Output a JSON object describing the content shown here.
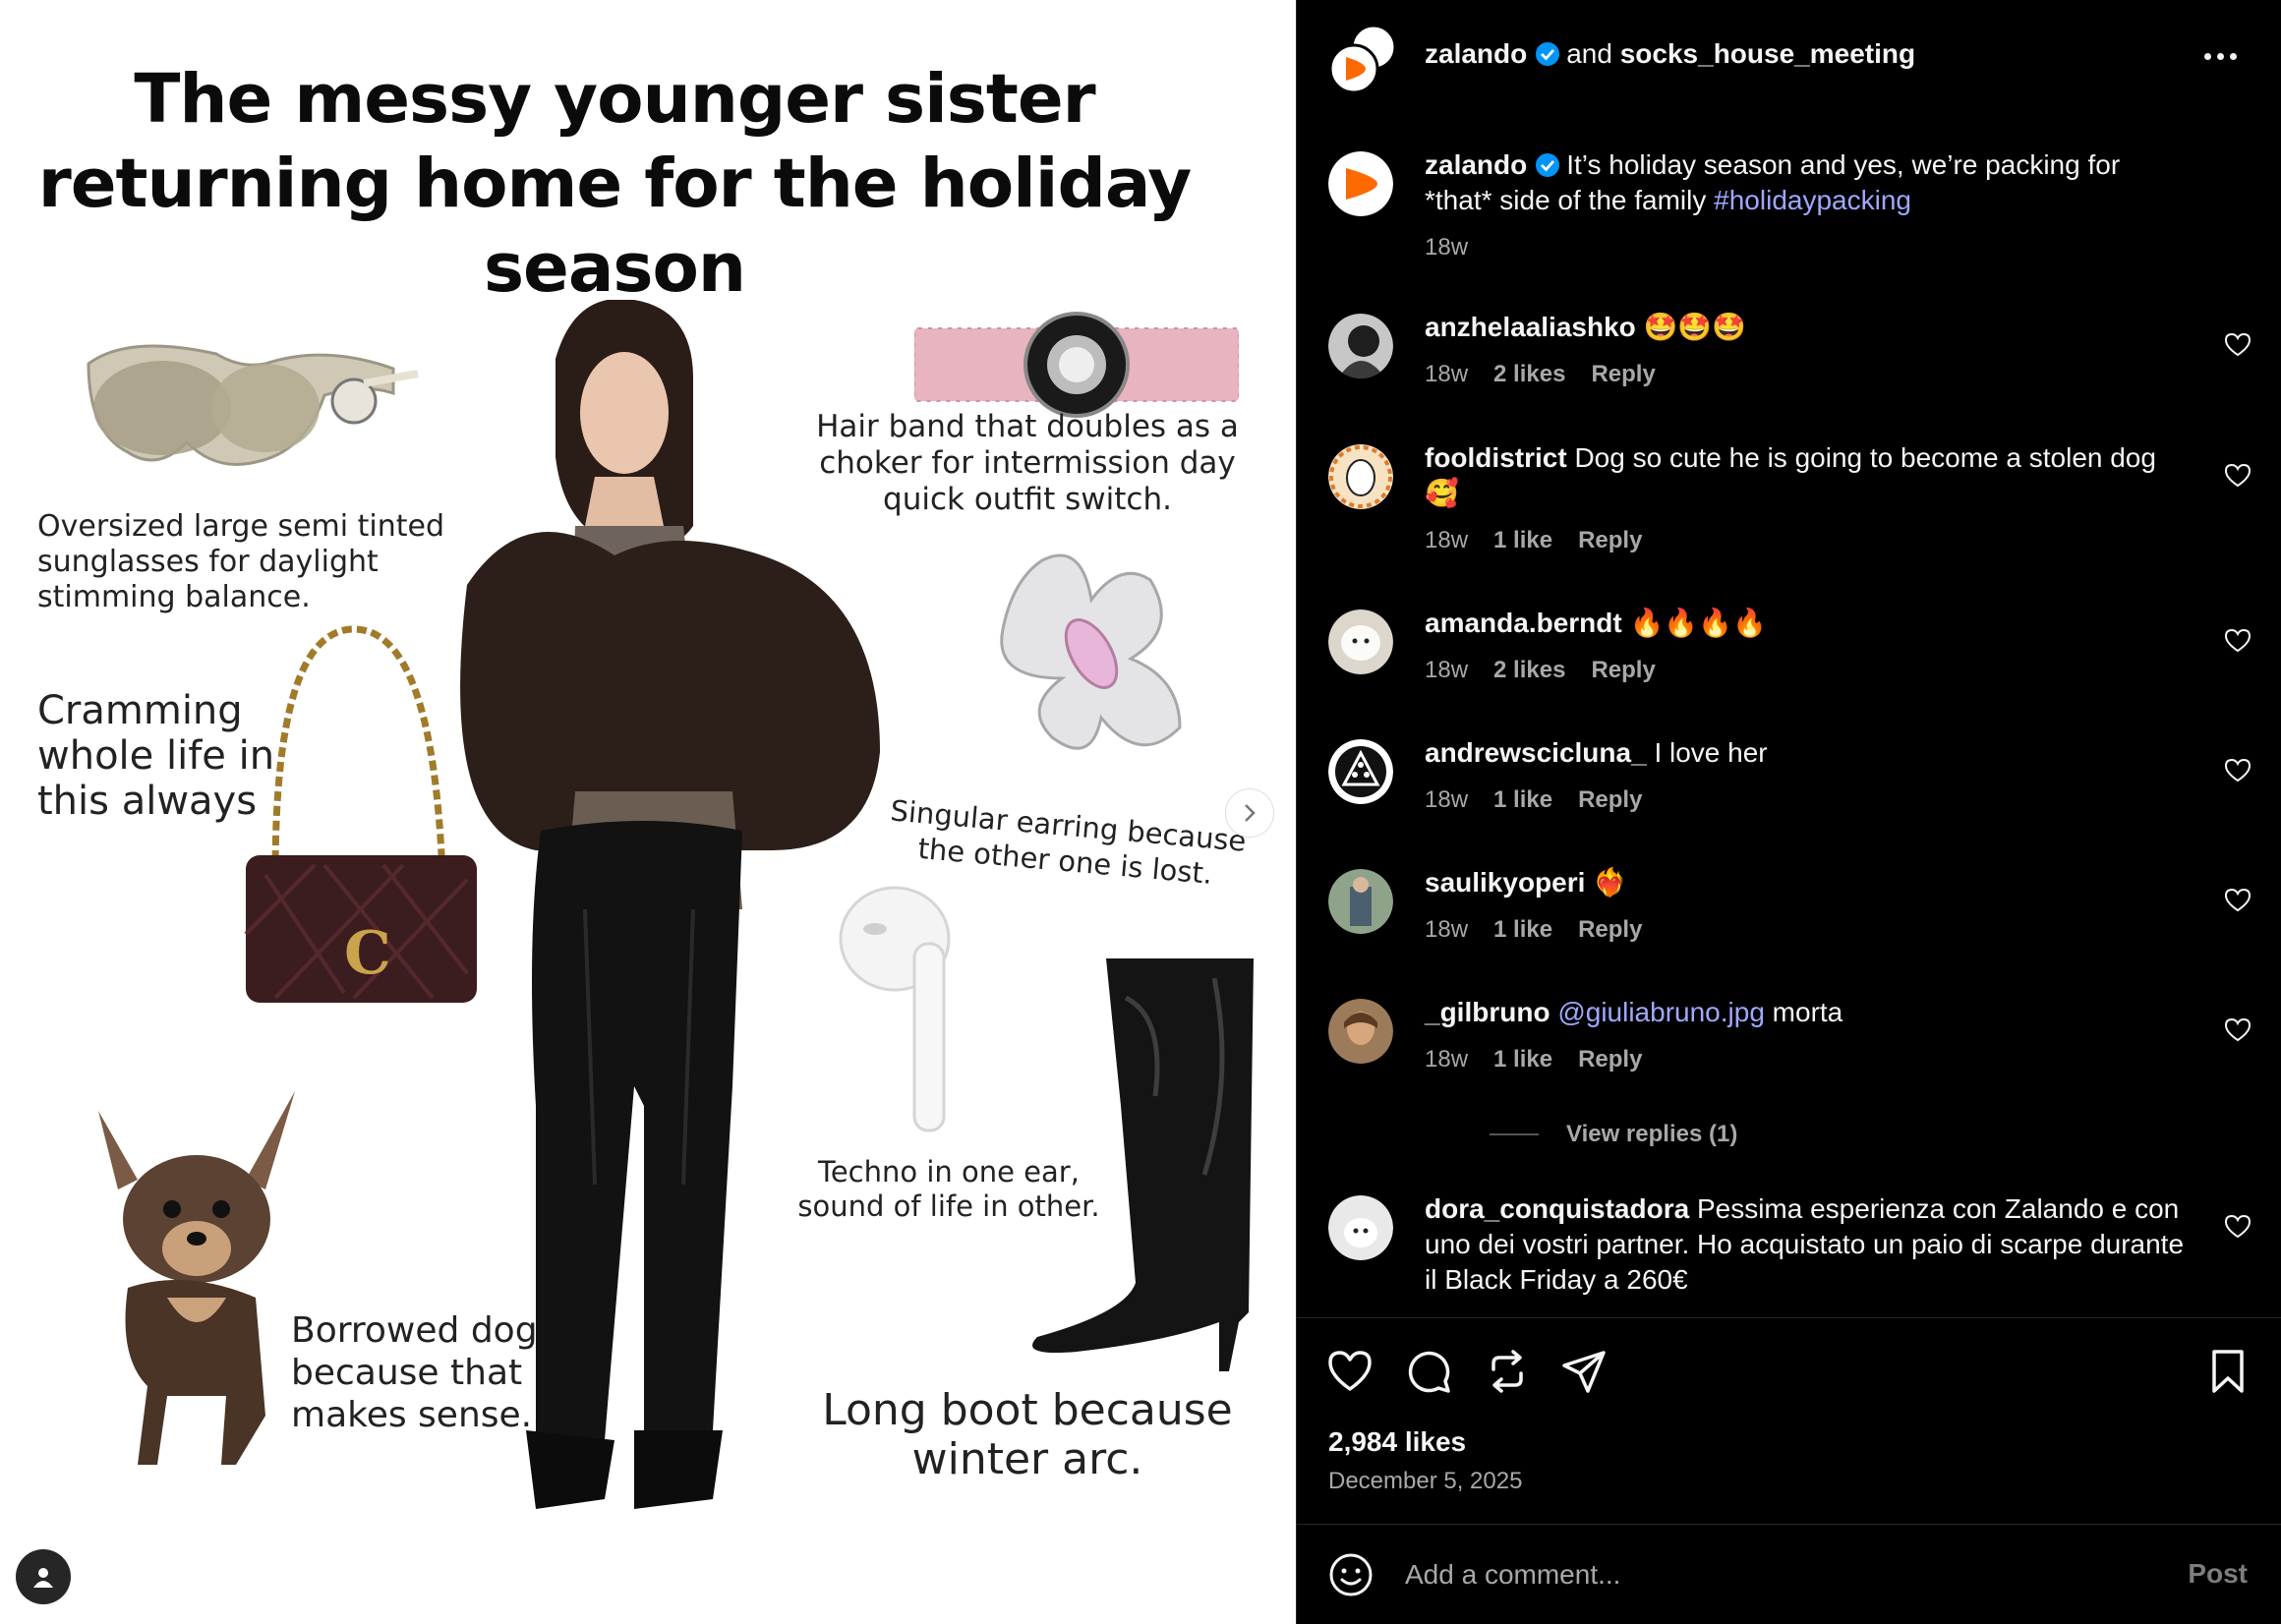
{
  "post_image": {
    "title": "The messy younger sister returning home for the holiday season",
    "captions": {
      "sunglasses": "Oversized large semi tinted sunglasses for daylight stimming balance.",
      "bag": "Cramming whole life in this always",
      "dog": "Borrowed dog because that makes sense.",
      "hairband": "Hair band that doubles as a choker for intermission day quick outfit switch.",
      "earring": "Singular earring because the other one is lost.",
      "earbud": "Techno in one ear, sound of life in other.",
      "boot": "Long boot because winter arc."
    },
    "icons": {
      "next": "chevron-right-icon",
      "user_tag": "person-icon"
    }
  },
  "header": {
    "author": "zalando",
    "joiner": "and",
    "collaborator": "socks_house_meeting"
  },
  "caption": {
    "author": "zalando",
    "text": "It’s holiday season and yes, we’re packing for *that* side of the family ",
    "hashtag": "#holidaypacking",
    "time": "18w"
  },
  "comments": [
    {
      "user": "anzhelaaliashko",
      "text": "🤩🤩🤩",
      "time": "18w",
      "likes": "2 likes",
      "reply": "Reply"
    },
    {
      "user": "fooldistrict",
      "text": "Dog so cute he is going to become a stolen dog 🥰",
      "time": "18w",
      "likes": "1 like",
      "reply": "Reply"
    },
    {
      "user": "amanda.berndt",
      "text": "🔥🔥🔥🔥",
      "time": "18w",
      "likes": "2 likes",
      "reply": "Reply"
    },
    {
      "user": "andrewscicluna_",
      "text": "I love her",
      "time": "18w",
      "likes": "1 like",
      "reply": "Reply"
    },
    {
      "user": "saulikyoperi",
      "text": "❤️‍🔥",
      "time": "18w",
      "likes": "1 like",
      "reply": "Reply"
    },
    {
      "user": "_gilbruno",
      "mention": "@giuliabruno.jpg",
      "text": " morta",
      "time": "18w",
      "likes": "1 like",
      "reply": "Reply"
    },
    {
      "user": "dora_conquistadora",
      "text": "Pessima esperienza con Zalando e con uno dei vostri partner. Ho acquistato un paio di scarpe durante il Black Friday a 260€"
    }
  ],
  "view_replies": "View replies (1)",
  "footer": {
    "likes": "2,984 likes",
    "date": "December 5, 2025",
    "comment_placeholder": "Add a comment...",
    "post_label": "Post"
  },
  "colors": {
    "background": "#000000",
    "text": "#f5f5f5",
    "secondary_text": "#a8a8a8",
    "link": "#9fa8ff",
    "verified": "#0095f6",
    "brand_orange": "#ff6900"
  }
}
